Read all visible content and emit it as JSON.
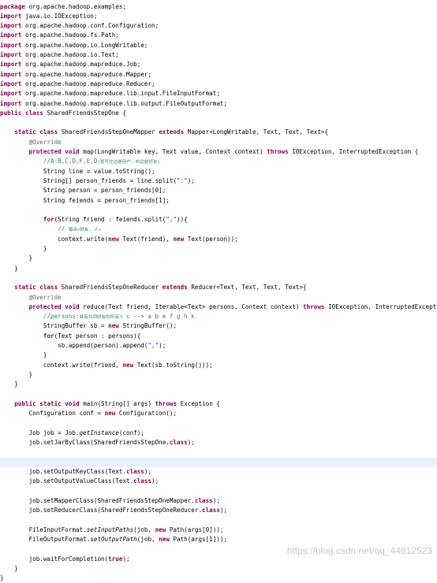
{
  "editor": {
    "current_line": 47,
    "lines": [
      [
        [
          "kw",
          "package"
        ],
        [
          "",
          "org.apache.hadoop.examples;"
        ]
      ],
      [
        [
          "kw",
          "import"
        ],
        [
          "",
          "java.io.IOException;"
        ]
      ],
      [
        [
          "kw",
          "import"
        ],
        [
          "",
          "org.apache.hadoop.conf.Configuration;"
        ]
      ],
      [
        [
          "kw",
          "import"
        ],
        [
          "",
          "org.apache.hadoop.fs.Path;"
        ]
      ],
      [
        [
          "kw",
          "import"
        ],
        [
          "",
          "org.apache.hadoop.io.LongWritable;"
        ]
      ],
      [
        [
          "kw",
          "import"
        ],
        [
          "",
          "org.apache.hadoop.io.Text;"
        ]
      ],
      [
        [
          "kw",
          "import"
        ],
        [
          "",
          "org.apache.hadoop.mapreduce.Job;"
        ]
      ],
      [
        [
          "kw",
          "import"
        ],
        [
          "",
          "org.apache.hadoop.mapreduce.Mapper;"
        ]
      ],
      [
        [
          "kw",
          "import"
        ],
        [
          "",
          "org.apache.hadoop.mapreduce.Reducer;"
        ]
      ],
      [
        [
          "kw",
          "import"
        ],
        [
          "",
          "org.apache.hadoop.mapreduce.lib.input.FileInputFormat;"
        ]
      ],
      [
        [
          "kw",
          "import"
        ],
        [
          "",
          "org.apache.hadoop.mapreduce.lib.output.FileOutputFormat;"
        ]
      ],
      [
        [
          "kw",
          "public class"
        ],
        [
          "",
          "SharedFriendsStepOne {"
        ]
      ],
      [],
      [
        [
          "",
          "    "
        ],
        [
          "kw",
          "static class"
        ],
        [
          "",
          "SharedFriendsStepOneMapper "
        ],
        [
          "kw",
          "extends"
        ],
        [
          "",
          "Mapper<LongWritable, Text, Text, Text>{"
        ]
      ],
      [
        [
          "",
          "        "
        ],
        [
          "an",
          "@Override"
        ]
      ],
      [
        [
          "",
          "        "
        ],
        [
          "kw",
          "protected void"
        ],
        [
          "",
          "map(LongWritable key, Text value, Context context) "
        ],
        [
          "kw",
          "throws"
        ],
        [
          "",
          "IOException, InterruptedException {"
        ]
      ],
      [
        [
          "",
          "            "
        ],
        [
          "cm",
          "//A:B,C,D,F,E,O"
        ],
        [
          "cm cjk",
          "(冒号左边是用户，右边是好友)"
        ]
      ],
      [
        [
          "",
          "            String line = value.toString();"
        ]
      ],
      [
        [
          "",
          "            String[] person_friends = line.split("
        ],
        [
          "st",
          "\":\""
        ],
        [
          "",
          ");"
        ]
      ],
      [
        [
          "",
          "            String person = person_friends[0];"
        ]
      ],
      [
        [
          "",
          "            String feiends = person_friends[1];"
        ]
      ],
      [],
      [
        [
          "",
          "            "
        ],
        [
          "kw",
          "for"
        ],
        [
          "",
          "(String friend : feiends.split("
        ],
        [
          "st",
          "\",\""
        ],
        [
          "",
          ")){"
        ]
      ],
      [
        [
          "",
          "                "
        ],
        [
          "cm",
          "// "
        ],
        [
          "cm cjk",
          "输出<好友, 人>"
        ]
      ],
      [
        [
          "",
          "                context.write("
        ],
        [
          "kw",
          "new"
        ],
        [
          "",
          "Text(friend), "
        ],
        [
          "kw",
          "new"
        ],
        [
          "",
          "Text(person));"
        ]
      ],
      [
        [
          "",
          "            }"
        ]
      ],
      [
        [
          "",
          "        }"
        ]
      ],
      [
        [
          "",
          "    }"
        ]
      ],
      [],
      [
        [
          "",
          "    "
        ],
        [
          "kw",
          "static class"
        ],
        [
          "",
          "SharedFriendsStepOneReducer "
        ],
        [
          "kw",
          "extends"
        ],
        [
          "",
          "Reducer<Text, Text, Text, Text>{"
        ]
      ],
      [
        [
          "",
          "        "
        ],
        [
          "an",
          "@Override"
        ]
      ],
      [
        [
          "",
          "        "
        ],
        [
          "kw",
          "protected void"
        ],
        [
          "",
          "reduce(Text friend, Iterable<Text> persons, Context context) "
        ],
        [
          "kw",
          "throws"
        ],
        [
          "",
          "IOException, InterruptedException {"
        ]
      ],
      [
        [
          "",
          "            "
        ],
        [
          "cm",
          "//persons:"
        ],
        [
          "cm cjk",
          "具有共同好友的所有人"
        ],
        [
          "cm",
          "c --> a b e f g h k"
        ]
      ],
      [
        [
          "",
          "            StringBuffer sb = "
        ],
        [
          "kw",
          "new"
        ],
        [
          "",
          "StringBuffer();"
        ]
      ],
      [
        [
          "",
          "            "
        ],
        [
          "kw",
          "for"
        ],
        [
          "",
          "(Text person : persons){"
        ]
      ],
      [
        [
          "",
          "                sb.append(person).append("
        ],
        [
          "st",
          "\",\""
        ],
        [
          "",
          ");"
        ]
      ],
      [
        [
          "",
          "            }"
        ]
      ],
      [
        [
          "",
          "            context.write(friend, "
        ],
        [
          "kw",
          "new"
        ],
        [
          "",
          "Text(sb.toString()));"
        ]
      ],
      [
        [
          "",
          "        }"
        ]
      ],
      [
        [
          "",
          "    }"
        ]
      ],
      [],
      [
        [
          "",
          "    "
        ],
        [
          "kw",
          "public static void"
        ],
        [
          "",
          "main(String[] args) "
        ],
        [
          "kw",
          "throws"
        ],
        [
          "",
          "Exception {"
        ]
      ],
      [
        [
          "",
          "        Configuration conf = "
        ],
        [
          "kw",
          "new"
        ],
        [
          "",
          "Configuration();"
        ]
      ],
      [],
      [
        [
          "",
          "        Job job = Job."
        ],
        [
          "it",
          "getInstance"
        ],
        [
          "",
          "(conf);"
        ]
      ],
      [
        [
          "",
          "        job.setJarByClass(SharedFriendsStepOne."
        ],
        [
          "kw",
          "class"
        ],
        [
          "",
          ");"
        ]
      ],
      [],
      [],
      [
        [
          "",
          "        job.setOutputKeyClass(Text."
        ],
        [
          "kw",
          "class"
        ],
        [
          "",
          ");"
        ]
      ],
      [
        [
          "",
          "        job.setOutputValueClass(Text."
        ],
        [
          "kw",
          "class"
        ],
        [
          "",
          ");"
        ]
      ],
      [],
      [
        [
          "",
          "        job.setMapperClass(SharedFriendsStepOneMapper."
        ],
        [
          "kw",
          "class"
        ],
        [
          "",
          ");"
        ]
      ],
      [
        [
          "",
          "        job.setReducerClass(SharedFriendsStepOneReducer."
        ],
        [
          "kw",
          "class"
        ],
        [
          "",
          ");"
        ]
      ],
      [],
      [
        [
          "",
          "        FileInputFormat."
        ],
        [
          "it",
          "setInputPaths"
        ],
        [
          "",
          "(job, "
        ],
        [
          "kw",
          "new"
        ],
        [
          "",
          "Path(args[0]));"
        ]
      ],
      [
        [
          "",
          "        FileOutputFormat."
        ],
        [
          "it",
          "setOutputPath"
        ],
        [
          "",
          "(job, "
        ],
        [
          "kw",
          "new"
        ],
        [
          "",
          "Path(args[1]));"
        ]
      ],
      [],
      [
        [
          "",
          "        job.waitForCompletion("
        ],
        [
          "kw",
          "true"
        ],
        [
          "",
          ");"
        ]
      ],
      [
        [
          "",
          "    }"
        ]
      ],
      [
        [
          "",
          "}"
        ]
      ]
    ],
    "watermark": "https://blog.csdn.net/qq_44812523"
  }
}
